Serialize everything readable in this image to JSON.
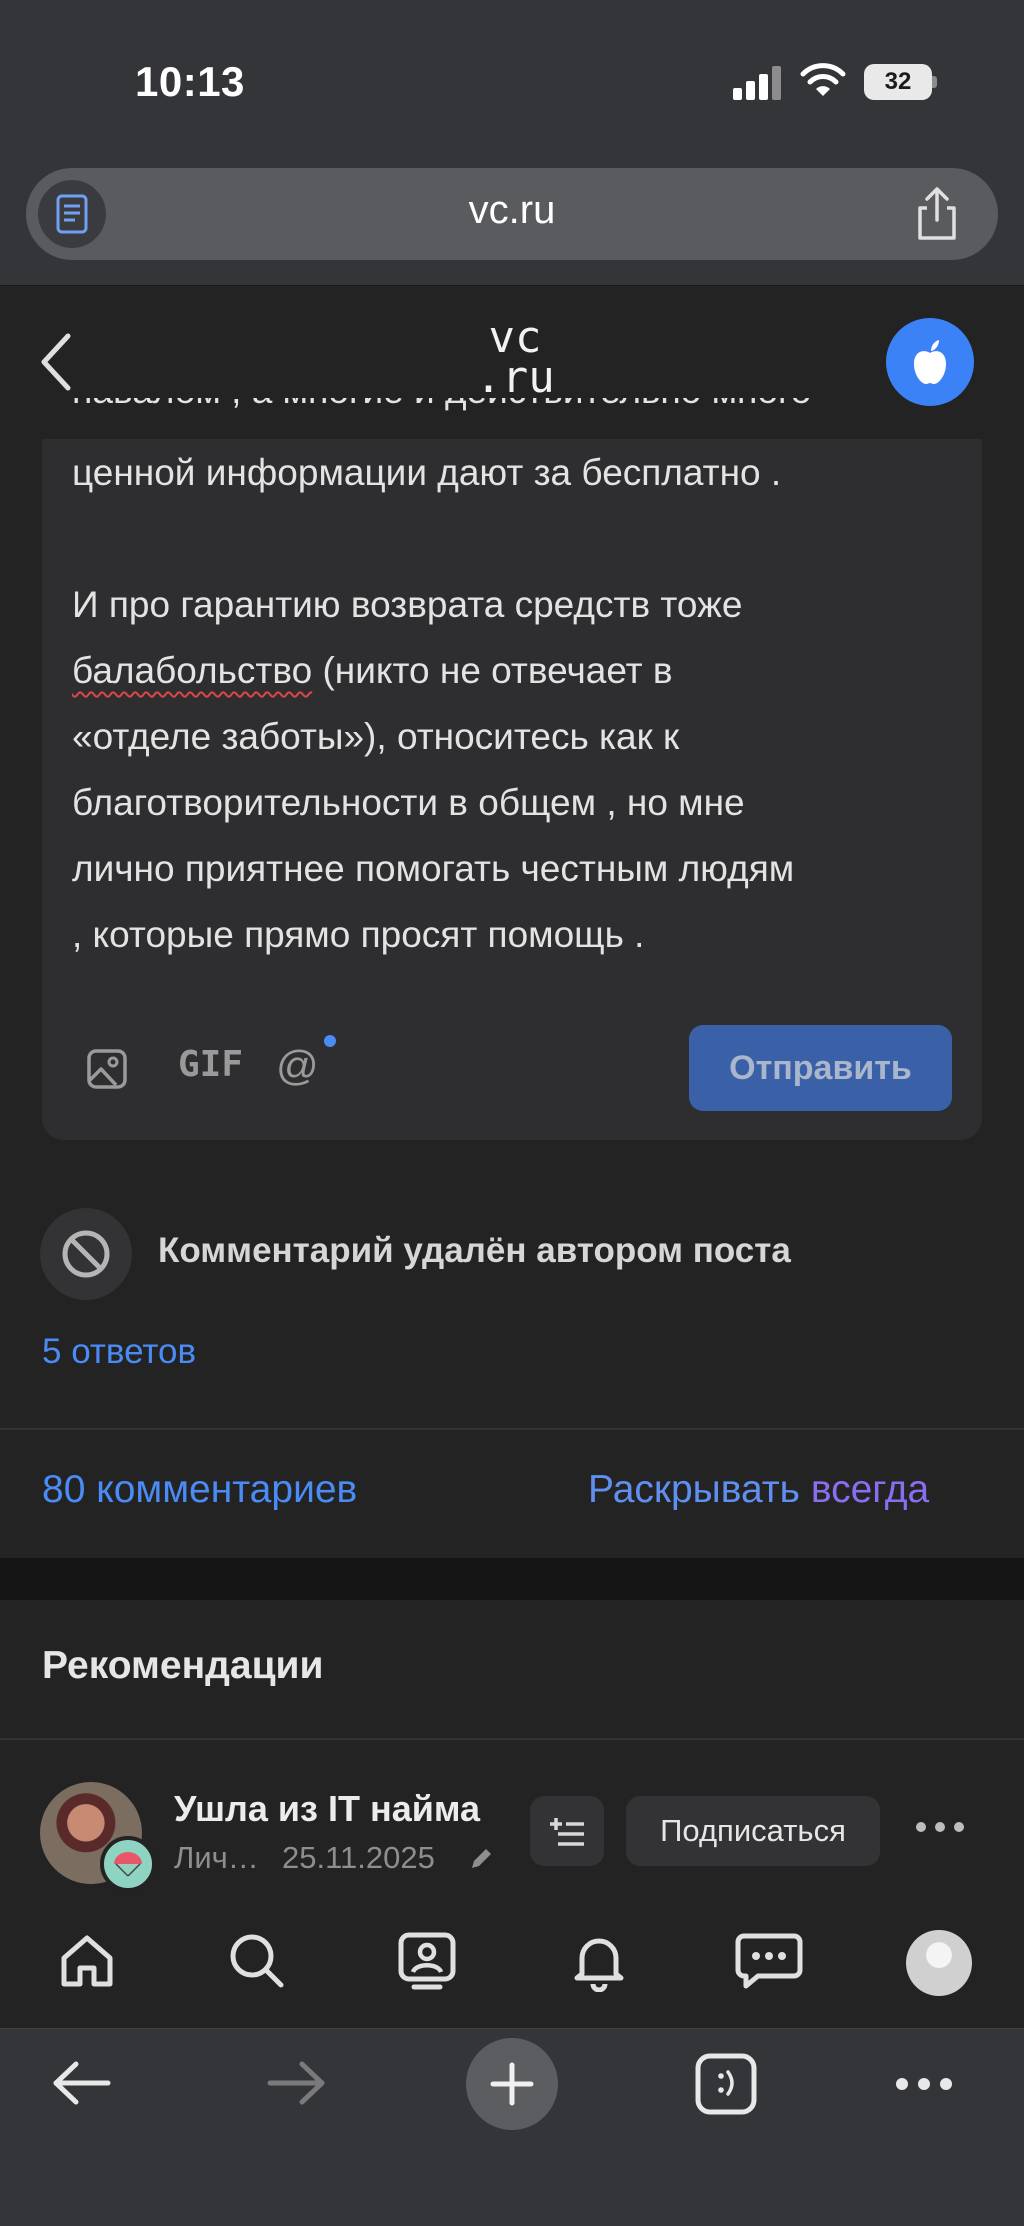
{
  "status_bar": {
    "time": "10:13",
    "battery": "32"
  },
  "browser": {
    "url": "vc.ru",
    "icons": [
      "reader-icon",
      "share-icon",
      "back-arrow-icon",
      "forward-arrow-icon",
      "new-tab-plus-icon",
      "tabs-icon",
      "more-icon"
    ]
  },
  "site": {
    "logo_top": "vc",
    "logo_bottom": ".ru"
  },
  "editor": {
    "paragraphs": [
      "навалом , а многие и действительно много",
      "ценной информации дают за бесплатно ."
    ],
    "para2_line1": "И про гарантию возврата средств тоже",
    "para2_word_flagged": "балабольство",
    "para2_line2_rest": " (никто не отвечает в",
    "para2_line3": "«отделе заботы»), относитесь как к",
    "para2_line4": "благотворительности в общем , но мне",
    "para2_line5": "лично приятнее помогать честным людям",
    "para2_line6": ", которые прямо просят помощь .",
    "gif_label": "GIF",
    "at_label": "@",
    "send_label": "Отправить"
  },
  "deleted_comment": {
    "text": "Комментарий удалён автором поста",
    "replies": "5 ответов"
  },
  "comments_bar": {
    "count": "80 комментариев",
    "expand_part1": "Раскрывать ",
    "expand_part2": "всегда"
  },
  "recommendations": {
    "title": "Рекомендации",
    "author_name": "Ушла из IT найма",
    "author_sub": "Лич…",
    "date": "25.11.2025",
    "subscribe_label": "Подписаться"
  },
  "colors": {
    "accent_blue": "#4a8bf5",
    "send_button": "#3a61a8",
    "background": "#232323",
    "chrome": "#343538"
  }
}
